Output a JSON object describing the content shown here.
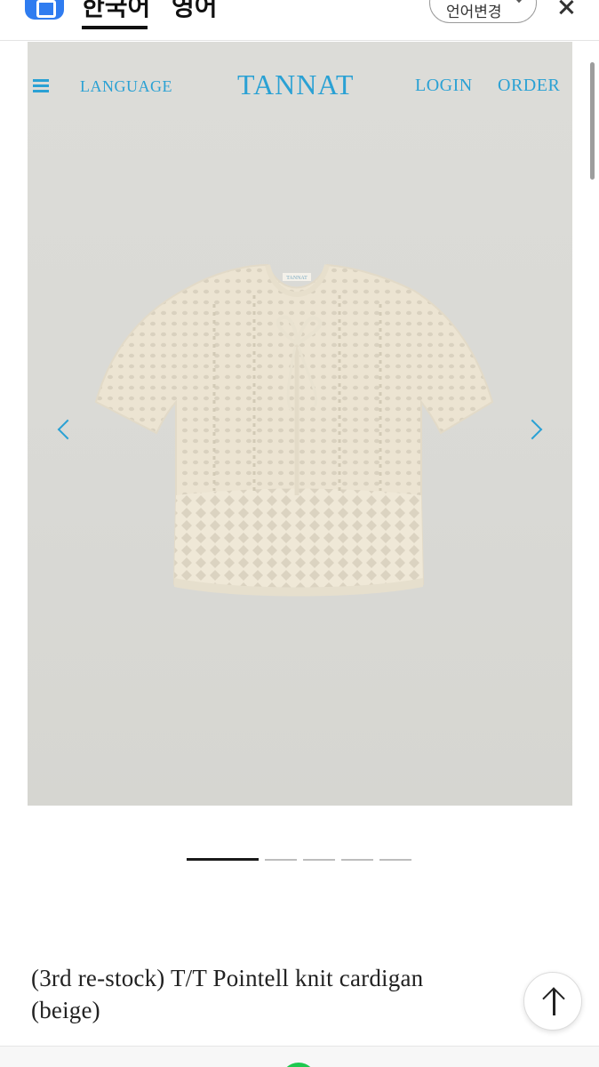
{
  "translate_bar": {
    "tabs": [
      {
        "label": "한국어",
        "active": true
      },
      {
        "label": "영어",
        "active": false
      }
    ],
    "change_language_label": "언어변경",
    "icons": {
      "app": "translate-app-icon",
      "close": "close-icon",
      "dropdown": "chevron-down-icon"
    }
  },
  "site_nav": {
    "menu_icon": "hamburger-menu-icon",
    "language_label": "LANGUAGE",
    "brand": "TANNAT",
    "login_label": "LOGIN",
    "order_label": "ORDER",
    "accent_color": "#2aa1d4"
  },
  "carousel": {
    "prev_icon": "chevron-left-icon",
    "next_icon": "chevron-right-icon",
    "slide_count": 5,
    "active_slide": 1,
    "garment_tag": "TANNAT"
  },
  "product": {
    "title_line1": "(3rd re-stock) T/T Pointell knit cardigan",
    "title_line2": "(beige)"
  },
  "scroll_to_top_icon": "arrow-up-icon"
}
